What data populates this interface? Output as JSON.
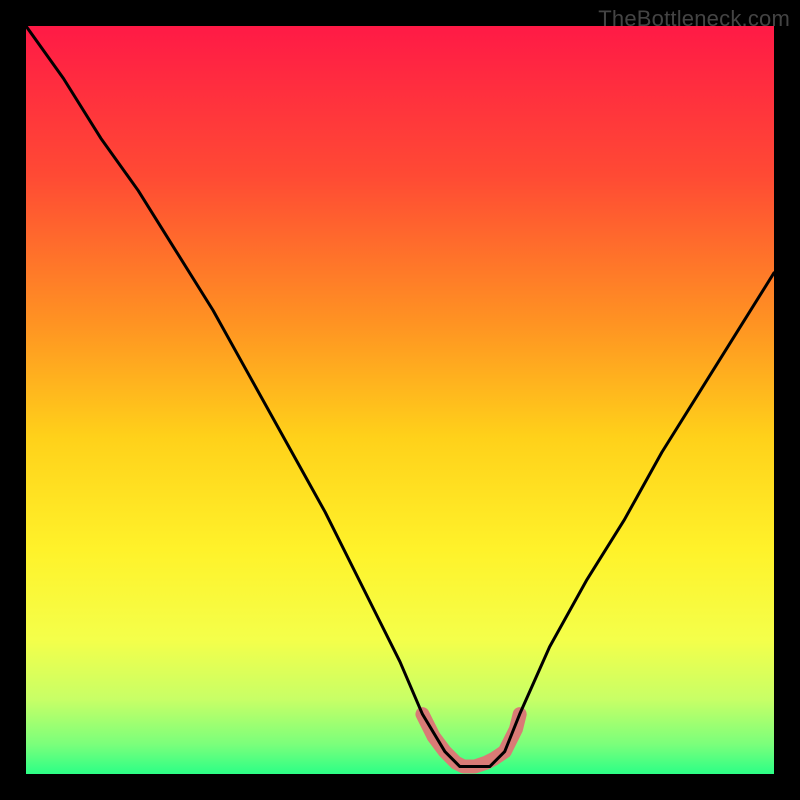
{
  "attribution": "TheBottleneck.com",
  "chart_data": {
    "type": "line",
    "title": "",
    "xlabel": "",
    "ylabel": "",
    "xlim": [
      0,
      100
    ],
    "ylim": [
      0,
      100
    ],
    "grid": false,
    "legend": false,
    "series": [
      {
        "name": "bottleneck-curve",
        "color": "#000000",
        "x": [
          0,
          5,
          10,
          15,
          20,
          25,
          30,
          35,
          40,
          45,
          50,
          53,
          56,
          58,
          60,
          62,
          64,
          66,
          70,
          75,
          80,
          85,
          90,
          95,
          100
        ],
        "values": [
          100,
          93,
          85,
          78,
          70,
          62,
          53,
          44,
          35,
          25,
          15,
          8,
          3,
          1,
          1,
          1,
          3,
          8,
          17,
          26,
          34,
          43,
          51,
          59,
          67
        ]
      },
      {
        "name": "trough-highlight",
        "color": "#d97b76",
        "x": [
          53,
          54.5,
          56,
          57.5,
          58.5,
          60,
          61.5,
          62.5,
          64,
          65.5,
          66
        ],
        "values": [
          8,
          5,
          3,
          1.5,
          1,
          1,
          1.5,
          2,
          3,
          6,
          8
        ]
      }
    ],
    "background_gradient": {
      "type": "linear-vertical",
      "stops": [
        {
          "pct": 0,
          "color": "#ff1a46"
        },
        {
          "pct": 20,
          "color": "#ff4a34"
        },
        {
          "pct": 40,
          "color": "#ff9422"
        },
        {
          "pct": 55,
          "color": "#ffd11a"
        },
        {
          "pct": 70,
          "color": "#fff22a"
        },
        {
          "pct": 82,
          "color": "#f4ff4a"
        },
        {
          "pct": 90,
          "color": "#c8ff66"
        },
        {
          "pct": 96,
          "color": "#7bff7b"
        },
        {
          "pct": 100,
          "color": "#2cff86"
        }
      ]
    }
  }
}
